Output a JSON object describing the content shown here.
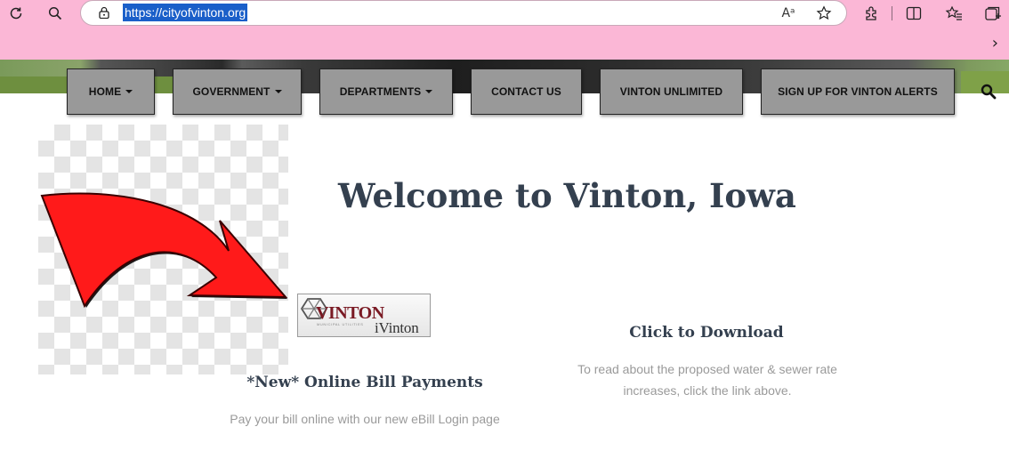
{
  "browser": {
    "url": "https://cityofvinton.org",
    "icons": [
      "refresh-icon",
      "search-icon",
      "lock-icon",
      "read-aloud-icon",
      "favorite-star-icon",
      "extensions-icon",
      "split-screen-icon",
      "favorites-icon",
      "collections-icon",
      "chevron-right-icon"
    ],
    "read_aloud_glyph": "Aᵃ",
    "toolbar_color": "#fbb7d6"
  },
  "nav": {
    "items": [
      {
        "label": "HOME",
        "dropdown": true
      },
      {
        "label": "GOVERNMENT",
        "dropdown": true
      },
      {
        "label": "DEPARTMENTS",
        "dropdown": true
      },
      {
        "label": "CONTACT US",
        "dropdown": false
      },
      {
        "label": "VINTON UNLIMITED",
        "dropdown": false
      },
      {
        "label": "SIGN UP FOR VINTON ALERTS",
        "dropdown": false
      }
    ],
    "button_color": "#999999"
  },
  "main": {
    "title": "Welcome to Vinton, Iowa",
    "logo": {
      "name": "VINTON",
      "subtitle": "MUNICIPAL UTILITIES",
      "tagline": "iVinton"
    },
    "bill": {
      "heading": "*New* Online Bill Payments",
      "text": "Pay your bill online with our new eBill Login page"
    },
    "download": {
      "heading": "Click to Download",
      "text": "To read about the proposed water & sewer rate increases, click the link above."
    },
    "heading_color": "#34404f",
    "arrow_color": "#ff1a1a"
  }
}
